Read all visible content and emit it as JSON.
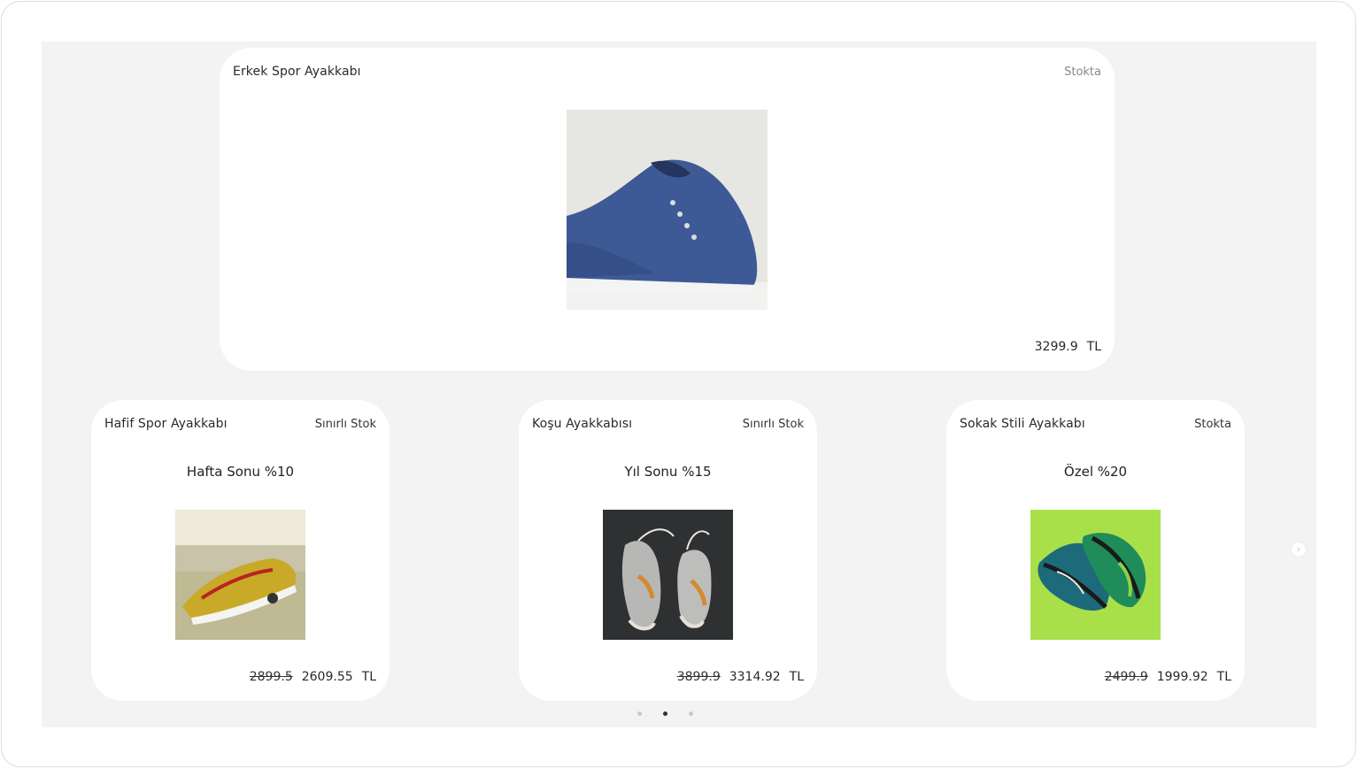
{
  "featured": {
    "title": "Erkek Spor Ayakkabı",
    "stock": "Stokta",
    "price": "3299.9",
    "currency": "TL",
    "image_icon": "blue-sneaker-image"
  },
  "cards": [
    {
      "title": "Hafif Spor Ayakkabı",
      "stock": "Sınırlı Stok",
      "promo": "Hafta Sonu %10",
      "old_price": "2899.5",
      "price": "2609.55",
      "currency": "TL",
      "image_icon": "gold-sneaker-image"
    },
    {
      "title": "Koşu Ayakkabısı",
      "stock": "Sınırlı Stok",
      "promo": "Yıl Sonu %15",
      "old_price": "3899.9",
      "price": "3314.92",
      "currency": "TL",
      "image_icon": "grey-high-top-sneakers-image"
    },
    {
      "title": "Sokak Stili Ayakkabı",
      "stock": "Stokta",
      "promo": "Özel %20",
      "old_price": "2499.9",
      "price": "1999.92",
      "currency": "TL",
      "image_icon": "green-running-shoes-image"
    }
  ],
  "carousel": {
    "page_count": 3,
    "active_page": 2,
    "next_icon": "chevron-right-icon"
  },
  "colors": {
    "stage_background": "#f3f3f3",
    "card_background": "#ffffff",
    "active_dot": "#333333",
    "inactive_dot": "#c8c8c8"
  }
}
